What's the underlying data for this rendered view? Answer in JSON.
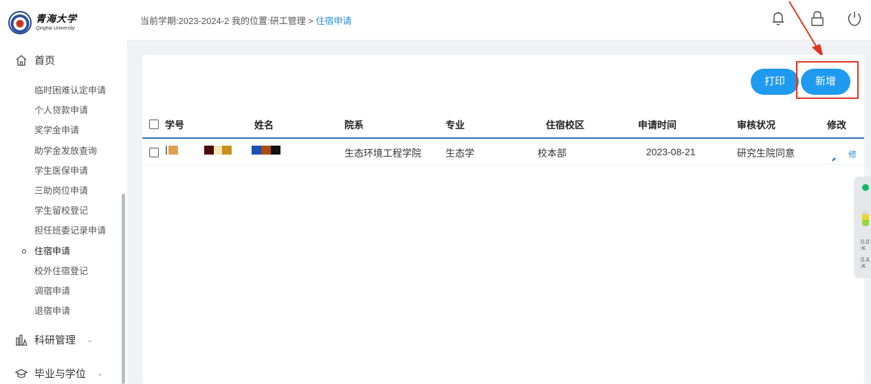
{
  "logo": {
    "cn": "青海大学",
    "en": "Qinghai University"
  },
  "sidebar": {
    "home_label": "首页",
    "sub_items": [
      "临时困难认定申请",
      "个人贷款申请",
      "奖学金申请",
      "助学金发放查询",
      "学生医保申请",
      "三助岗位申请",
      "学生留校登记",
      "担任班委记录申请",
      "住宿申请",
      "校外住宿登记",
      "调宿申请",
      "退宿申请"
    ],
    "active_index": 8,
    "groups": [
      {
        "label": "科研管理",
        "icon": "bar-chart-icon"
      },
      {
        "label": "毕业与学位",
        "icon": "graduation-cap-icon"
      }
    ]
  },
  "header": {
    "breadcrumb_prefix": "当前学期:2023-2024-2 我的位置:研工管理 > ",
    "breadcrumb_current": "住宿申请",
    "icons": [
      "bell-icon",
      "lock-icon",
      "power-icon"
    ]
  },
  "toolbar": {
    "print_label": "打印",
    "add_label": "新增"
  },
  "table": {
    "columns": [
      "学号",
      "姓名",
      "院系",
      "专业",
      "住宿校区",
      "申请时间",
      "审核状况",
      "修改"
    ],
    "rows": [
      {
        "student_id": "",
        "name": "",
        "department": "生态环境工程学院",
        "major": "生态学",
        "campus": "校本部",
        "date": "2023-08-21",
        "status": "研究生院同意",
        "edit": "修"
      }
    ]
  },
  "widget": {
    "line1": "0.0",
    "unit1": "K",
    "line2": "0.4",
    "unit2": "K"
  },
  "colors": {
    "accent": "#1e9bf0",
    "annotation": "#e2321c",
    "link": "#2c8bd6"
  }
}
